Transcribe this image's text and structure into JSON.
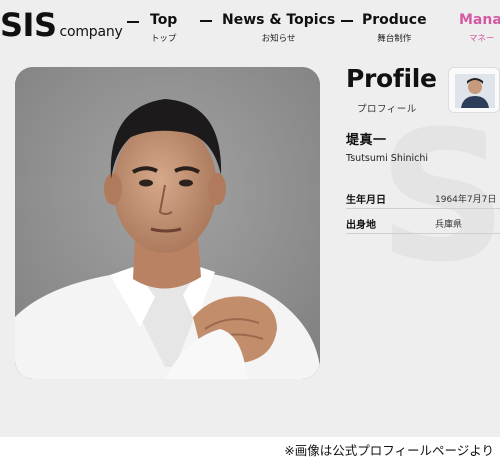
{
  "logo": {
    "brand": "SIS",
    "sub": "company"
  },
  "nav": [
    {
      "en": "Top",
      "ja": "トップ"
    },
    {
      "en": "News & Topics",
      "ja": "お知らせ"
    },
    {
      "en": "Produce",
      "ja": "舞台制作"
    },
    {
      "en": "Mana",
      "ja": "マネー"
    }
  ],
  "profile": {
    "title": "Profile",
    "subtitle": "プロフィール",
    "name_ja": "堤真一",
    "name_en": "Tsutsumi Shinichi",
    "rows": [
      {
        "label": "生年月日",
        "value": "1964年7月7日"
      },
      {
        "label": "出身地",
        "value": "兵庫県"
      }
    ],
    "watermark": "SS"
  },
  "caption": "※画像は公式プロフィールページより",
  "colors": {
    "accent": "#d45aa3",
    "page_bg": "#efeeee"
  },
  "icons": {
    "portrait": "person-portrait-photo",
    "thumb": "person-avatar-icon"
  }
}
